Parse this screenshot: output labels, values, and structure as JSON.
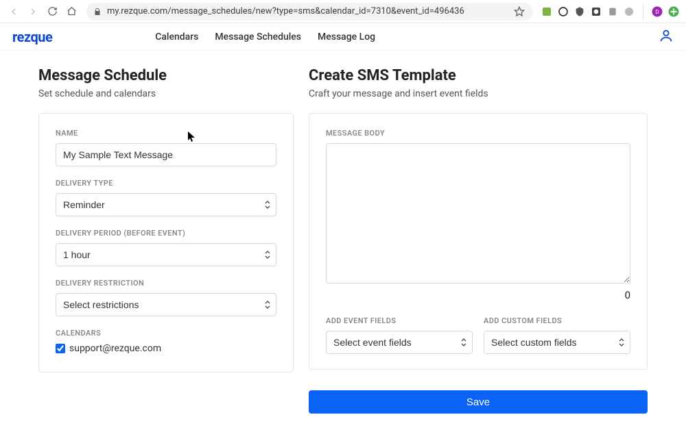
{
  "browser": {
    "url": "my.rezque.com/message_schedules/new?type=sms&calendar_id=7310&event_id=496436"
  },
  "nav": {
    "logo": "rezque",
    "links": [
      "Calendars",
      "Message Schedules",
      "Message Log"
    ]
  },
  "left": {
    "title": "Message Schedule",
    "subtitle": "Set schedule and calendars",
    "name_label": "NAME",
    "name_value": "My Sample Text Message",
    "delivery_type_label": "DELIVERY TYPE",
    "delivery_type_value": "Reminder",
    "delivery_period_label": "DELIVERY PERIOD (BEFORE EVENT)",
    "delivery_period_value": "1 hour",
    "delivery_restriction_label": "DELIVERY RESTRICTION",
    "delivery_restriction_value": "Select restrictions",
    "calendars_label": "CALENDARS",
    "calendar_item": "support@rezque.com"
  },
  "right": {
    "title": "Create SMS Template",
    "subtitle": "Craft your message and insert event fields",
    "body_label": "MESSAGE BODY",
    "char_count": "0",
    "event_fields_label": "ADD EVENT FIELDS",
    "event_fields_value": "Select event fields",
    "custom_fields_label": "ADD CUSTOM FIELDS",
    "custom_fields_value": "Select custom fields",
    "save_label": "Save"
  }
}
